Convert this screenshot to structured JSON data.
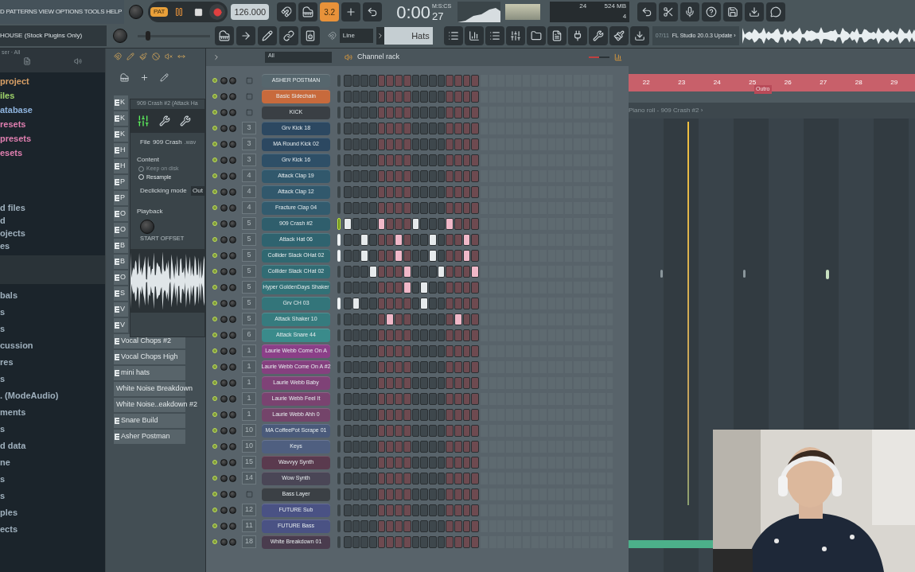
{
  "menu": {
    "items": [
      "D",
      "PATTERNS",
      "VIEW",
      "OPTIONS",
      "TOOLS",
      "HELP"
    ],
    "project_title": "HOUSE (Stock Plugins Only)"
  },
  "transport": {
    "master_pitch": {
      "level": 0.1
    },
    "pattern_label": "PAT",
    "tempo": "126.000",
    "snap_badge": "3.2",
    "time": "0:00",
    "time_cs": "27",
    "time_label": "M:S:CS",
    "cpu": "24",
    "memory": "524 MB",
    "polyphony": "4",
    "snap_mode": "Line",
    "pattern": "Hats",
    "news_index": "07/11",
    "news": "FL Studio 20.0.3 Update ›"
  },
  "browser": {
    "header": "ser · All",
    "items": [
      {
        "label": "project",
        "color": "#d9a066"
      },
      {
        "label": "iles",
        "color": "#9fd36a"
      },
      {
        "label": "atabase",
        "color": "#8fb4de"
      },
      {
        "label": "resets",
        "color": "#e07fb0"
      },
      {
        "label": "presets",
        "color": "#e07fb0"
      },
      {
        "label": "esets",
        "color": "#e07fb0"
      }
    ],
    "items_2": [
      {
        "label": "d files",
        "color": "#9fb0bd"
      },
      {
        "label": "d",
        "color": "#9fb0bd"
      },
      {
        "label": "ojects",
        "color": "#9fb0bd"
      },
      {
        "label": "es",
        "color": "#9fb0bd"
      }
    ],
    "items_3": [
      {
        "label": "bals",
        "color": "#9fb0bd"
      },
      {
        "label": "s",
        "color": "#9fb0bd"
      },
      {
        "label": "s",
        "color": "#9fb0bd"
      },
      {
        "label": "cussion",
        "color": "#9fb0bd"
      },
      {
        "label": "res",
        "color": "#9fb0bd"
      },
      {
        "label": "s",
        "color": "#9fb0bd"
      },
      {
        "label": ". (ModeAudio)",
        "color": "#9fb0bd"
      },
      {
        "label": "ments",
        "color": "#9fb0bd"
      },
      {
        "label": "s",
        "color": "#9fb0bd"
      },
      {
        "label": "d data",
        "color": "#9fb0bd"
      },
      {
        "label": "ne",
        "color": "#9fb0bd"
      },
      {
        "label": "s",
        "color": "#9fb0bd"
      },
      {
        "label": "s",
        "color": "#9fb0bd"
      },
      {
        "label": "ples",
        "color": "#9fb0bd"
      },
      {
        "label": "ects",
        "color": "#9fb0bd"
      }
    ]
  },
  "clips": {
    "hidden_items": [
      "K",
      "K",
      "K",
      "H",
      "H",
      "P",
      "P",
      "O",
      "O",
      "B",
      "B",
      "O",
      "S",
      "V",
      "V"
    ],
    "items": [
      "Vocal Chops #2",
      "Vocal Chops High",
      "mini hats",
      "White Noise Breakdown",
      "White Noise..eakdown #2",
      "Snare Build",
      "Asher Postman"
    ]
  },
  "sampler": {
    "title": "909 Crash #2 (Attack Ha",
    "file_label": "File",
    "file": "909 Crash",
    "file_ext": ".wav",
    "content_label": "Content",
    "options": [
      {
        "label": "Keep on disk",
        "checked": false,
        "disabled": true
      },
      {
        "label": "Resample",
        "checked": false,
        "disabled": false
      }
    ],
    "declicking_label": "Declicking mode",
    "declicking_value": "Out",
    "playback_label": "Playback",
    "knob_label": "START OFFSET"
  },
  "channel_rack": {
    "filter": "All",
    "title": "Channel rack",
    "swing": {
      "level": 0.5
    },
    "channels": [
      {
        "name": "ASHER POSTMAN",
        "color": "#56666d",
        "selected": false,
        "lit": false,
        "steps": [
          false,
          false,
          false,
          false,
          false,
          false,
          false,
          false,
          false,
          false,
          false,
          false,
          false,
          false,
          false,
          false
        ]
      },
      {
        "name": "Basic Sidechain",
        "color": "#c86a3c",
        "selected": false,
        "lit": false,
        "steps": [
          false,
          false,
          false,
          false,
          false,
          false,
          false,
          false,
          false,
          false,
          false,
          false,
          false,
          false,
          false,
          false
        ]
      },
      {
        "name": "KICK",
        "color": "#3a3f44",
        "selected": false,
        "lit": false,
        "steps": [
          false,
          false,
          false,
          false,
          false,
          false,
          false,
          false,
          false,
          false,
          false,
          false,
          false,
          false,
          false,
          false
        ]
      },
      {
        "name": "Grv Kick 18",
        "track": "3",
        "color": "#2c4861",
        "selected": false,
        "lit": false,
        "steps": [
          false,
          false,
          false,
          false,
          false,
          false,
          false,
          false,
          false,
          false,
          false,
          false,
          false,
          false,
          false,
          false
        ]
      },
      {
        "name": "MA Round Kick 02",
        "track": "3",
        "color": "#2c4861",
        "selected": false,
        "lit": false,
        "steps": [
          false,
          false,
          false,
          false,
          false,
          false,
          false,
          false,
          false,
          false,
          false,
          false,
          false,
          false,
          false,
          false
        ]
      },
      {
        "name": "Grv Kick 16",
        "track": "3",
        "color": "#2e4f67",
        "selected": false,
        "lit": false,
        "steps": [
          false,
          false,
          false,
          false,
          false,
          false,
          false,
          false,
          false,
          false,
          false,
          false,
          false,
          false,
          false,
          false
        ]
      },
      {
        "name": "Attack Clap 19",
        "track": "4",
        "color": "#31586c",
        "selected": false,
        "lit": false,
        "steps": [
          false,
          false,
          false,
          false,
          false,
          false,
          false,
          false,
          false,
          false,
          false,
          false,
          false,
          false,
          false,
          false
        ]
      },
      {
        "name": "Attack Clap 12",
        "track": "4",
        "color": "#31586c",
        "selected": false,
        "lit": false,
        "steps": [
          false,
          false,
          false,
          false,
          false,
          false,
          false,
          false,
          false,
          false,
          false,
          false,
          false,
          false,
          false,
          false
        ]
      },
      {
        "name": "Fracture Clap 04",
        "track": "4",
        "color": "#325b6e",
        "selected": false,
        "lit": false,
        "steps": [
          false,
          false,
          false,
          false,
          false,
          false,
          false,
          false,
          false,
          false,
          false,
          false,
          false,
          false,
          false,
          false
        ]
      },
      {
        "name": "909 Crash #2",
        "track": "5",
        "color": "#2f5e6c",
        "selected": true,
        "lit": false,
        "steps": [
          true,
          false,
          false,
          false,
          true,
          false,
          false,
          false,
          true,
          false,
          false,
          false,
          true,
          false,
          false,
          false
        ]
      },
      {
        "name": "Attack Hat 06",
        "track": "5",
        "color": "#2f636f",
        "selected": false,
        "lit": true,
        "steps": [
          false,
          false,
          true,
          false,
          false,
          false,
          true,
          false,
          false,
          false,
          true,
          false,
          false,
          false,
          true,
          false
        ]
      },
      {
        "name": "Collider Slack OHat 02",
        "track": "5",
        "color": "#306871",
        "selected": false,
        "lit": true,
        "steps": [
          false,
          false,
          true,
          false,
          false,
          false,
          true,
          false,
          false,
          false,
          true,
          false,
          false,
          false,
          true,
          false
        ]
      },
      {
        "name": "Collider Slack CHat 02",
        "track": "5",
        "color": "#316c74",
        "selected": false,
        "lit": false,
        "steps": [
          false,
          false,
          false,
          true,
          false,
          false,
          false,
          true,
          false,
          false,
          false,
          true,
          false,
          false,
          false,
          true
        ]
      },
      {
        "name": "Hyper GoldenDays Shaker",
        "track": "5",
        "color": "#327177",
        "selected": false,
        "lit": false,
        "steps": [
          false,
          false,
          false,
          false,
          false,
          false,
          false,
          true,
          false,
          true,
          false,
          false,
          false,
          false,
          false,
          false
        ]
      },
      {
        "name": "Grv CH 03",
        "track": "5",
        "color": "#33757a",
        "selected": false,
        "lit": true,
        "steps": [
          false,
          true,
          false,
          false,
          false,
          false,
          false,
          false,
          false,
          true,
          false,
          false,
          false,
          false,
          false,
          false
        ]
      },
      {
        "name": "Attack Shaker 10",
        "track": "5",
        "color": "#367b7e",
        "selected": false,
        "lit": false,
        "steps": [
          false,
          false,
          false,
          false,
          false,
          true,
          false,
          false,
          false,
          false,
          false,
          false,
          false,
          true,
          false,
          false
        ]
      },
      {
        "name": "Attack Snare 44",
        "track": "6",
        "color": "#3a8b8b",
        "selected": false,
        "lit": false,
        "steps": [
          false,
          false,
          false,
          false,
          false,
          false,
          false,
          false,
          false,
          false,
          false,
          false,
          false,
          false,
          false,
          false
        ]
      },
      {
        "name": "Laurie Webb Come On A",
        "track": "1",
        "color": "#8b3f88",
        "selected": false,
        "lit": false,
        "steps": [
          false,
          false,
          false,
          false,
          false,
          false,
          false,
          false,
          false,
          false,
          false,
          false,
          false,
          false,
          false,
          false
        ]
      },
      {
        "name": "Laurie Webb Come On A #2",
        "track": "1",
        "color": "#85407f",
        "selected": false,
        "lit": false,
        "steps": [
          false,
          false,
          false,
          false,
          false,
          false,
          false,
          false,
          false,
          false,
          false,
          false,
          false,
          false,
          false,
          false
        ]
      },
      {
        "name": "Laurie Webb Baby",
        "track": "1",
        "color": "#7f4277",
        "selected": false,
        "lit": false,
        "steps": [
          false,
          false,
          false,
          false,
          false,
          false,
          false,
          false,
          false,
          false,
          false,
          false,
          false,
          false,
          false,
          false
        ]
      },
      {
        "name": "Laurie Webb Feel It",
        "track": "1",
        "color": "#7a4370",
        "selected": false,
        "lit": false,
        "steps": [
          false,
          false,
          false,
          false,
          false,
          false,
          false,
          false,
          false,
          false,
          false,
          false,
          false,
          false,
          false,
          false
        ]
      },
      {
        "name": "Laurie Webb Ahh 0",
        "track": "1",
        "color": "#74446a",
        "selected": false,
        "lit": false,
        "steps": [
          false,
          false,
          false,
          false,
          false,
          false,
          false,
          false,
          false,
          false,
          false,
          false,
          false,
          false,
          false,
          false
        ]
      },
      {
        "name": "MA CoffeePot Scrape 01",
        "track": "10",
        "color": "#4a5a7a",
        "selected": false,
        "lit": false,
        "steps": [
          false,
          false,
          false,
          false,
          false,
          false,
          false,
          false,
          false,
          false,
          false,
          false,
          false,
          false,
          false,
          false
        ]
      },
      {
        "name": "Keys",
        "track": "10",
        "color": "#4f5f80",
        "selected": false,
        "lit": false,
        "steps": [
          false,
          false,
          false,
          false,
          false,
          false,
          false,
          false,
          false,
          false,
          false,
          false,
          false,
          false,
          false,
          false
        ]
      },
      {
        "name": "Wavvyy Synth",
        "track": "15",
        "color": "#5a3a4e",
        "selected": false,
        "lit": false,
        "steps": [
          false,
          false,
          false,
          false,
          false,
          false,
          false,
          false,
          false,
          false,
          false,
          false,
          false,
          false,
          false,
          false
        ]
      },
      {
        "name": "Wow Synth",
        "track": "14",
        "color": "#4a4656",
        "selected": false,
        "lit": false,
        "steps": [
          false,
          false,
          false,
          false,
          false,
          false,
          false,
          false,
          false,
          false,
          false,
          false,
          false,
          false,
          false,
          false
        ]
      },
      {
        "name": "Bass Layer",
        "color": "#3b4045",
        "selected": false,
        "lit": false,
        "steps": [
          false,
          false,
          false,
          false,
          false,
          false,
          false,
          false,
          false,
          false,
          false,
          false,
          false,
          false,
          false,
          false
        ]
      },
      {
        "name": "FUTURE Sub",
        "track": "12",
        "color": "#4a5284",
        "selected": false,
        "lit": false,
        "steps": [
          false,
          false,
          false,
          false,
          false,
          false,
          false,
          false,
          false,
          false,
          false,
          false,
          false,
          false,
          false,
          false
        ]
      },
      {
        "name": "FUTURE Bass",
        "track": "11",
        "color": "#4a5284",
        "selected": false,
        "lit": false,
        "steps": [
          false,
          false,
          false,
          false,
          false,
          false,
          false,
          false,
          false,
          false,
          false,
          false,
          false,
          false,
          false,
          false
        ]
      },
      {
        "name": "White Breakdown 01",
        "track": "18",
        "color": "#4a3c4e",
        "selected": false,
        "lit": false,
        "steps": [
          false,
          false,
          false,
          false,
          false,
          false,
          false,
          false,
          false,
          false,
          false,
          false,
          false,
          false,
          false,
          false
        ]
      }
    ]
  },
  "playlist": {
    "ruler": [
      "22",
      "23",
      "24",
      "25",
      "26",
      "27",
      "28",
      "29"
    ],
    "marker": "Outro",
    "piano_roll_title": "Piano roll - 909 Crash #2 ›"
  }
}
